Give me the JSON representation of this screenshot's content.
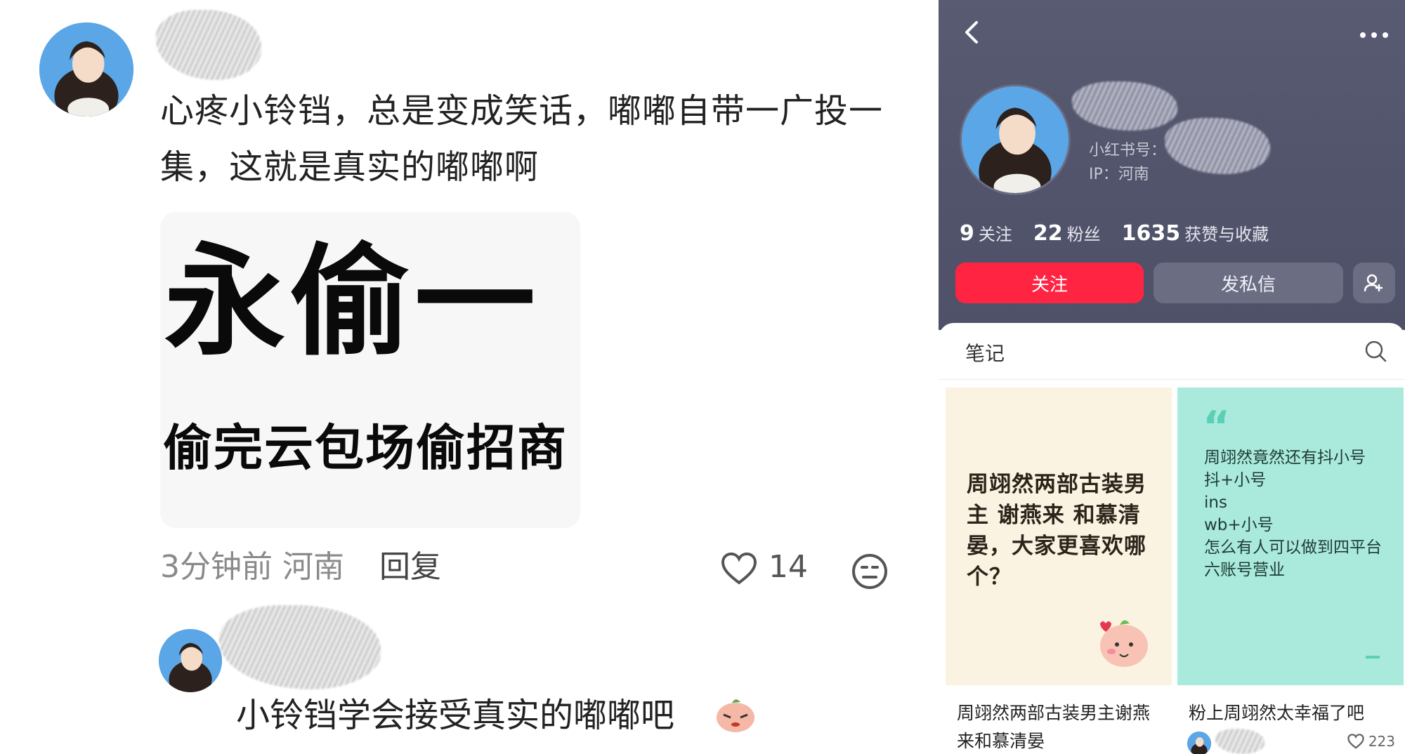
{
  "comment": {
    "text": "心疼小铃铛，总是变成笑话，嘟嘟自带一广投一集，这就是真实的嘟嘟啊",
    "image_title": "永偷一",
    "image_subtitle": "偷完云包场偷招商",
    "time_location": "3分钟前 河南",
    "reply_label": "回复",
    "like_count": "14"
  },
  "reply": {
    "text": "小铃铛学会接受真实的嘟嘟吧"
  },
  "profile": {
    "id_label": "小红书号：",
    "ip_label": "IP：河南",
    "stats": [
      {
        "num": "9",
        "label": "关注"
      },
      {
        "num": "22",
        "label": "粉丝"
      },
      {
        "num": "1635",
        "label": "获赞与收藏"
      }
    ],
    "follow_label": "关注",
    "message_label": "发私信"
  },
  "notes": {
    "tab_label": "笔记",
    "cards": [
      {
        "cover_text": "周翊然两部古装男主 谢燕来 和慕清晏，大家更喜欢哪个？",
        "title": "周翊然两部古装男主谢燕来和慕清晏"
      },
      {
        "cover_text": "周翊然竟然还有抖小号\n抖+小号\nins\nwb+小号\n怎么有人可以做到四平台六账号营业",
        "title": "粉上周翊然太幸福了吧",
        "likes": "223"
      }
    ]
  },
  "colors": {
    "accent": "#ff2442",
    "hero_bg": "#55576e",
    "card1_bg": "#fbf3e1",
    "card2_bg": "#aaeadd"
  }
}
